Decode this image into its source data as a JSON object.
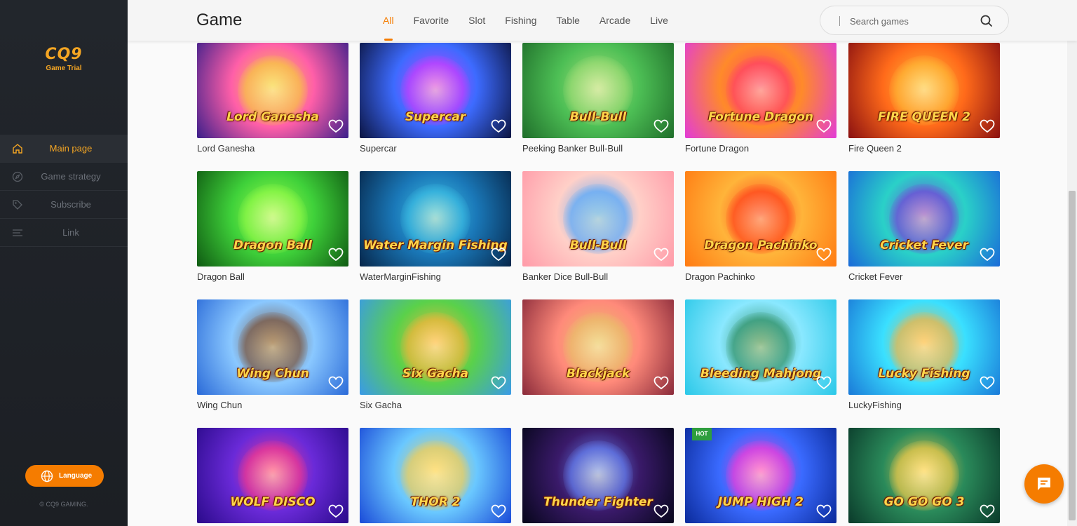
{
  "brand": {
    "logo_text": "CQ9",
    "logo_sub": "Game Trial",
    "accent": "#f57c00"
  },
  "sidebar": {
    "items": [
      {
        "label": "Main page",
        "icon": "home-icon",
        "active": true
      },
      {
        "label": "Game strategy",
        "icon": "compass-icon",
        "active": false
      },
      {
        "label": "Subscribe",
        "icon": "tag-icon",
        "active": false
      },
      {
        "label": "Link",
        "icon": "menu-lines-icon",
        "active": false
      }
    ],
    "language_label": "Language",
    "copyright": "© CQ9 GAMING."
  },
  "header": {
    "title": "Game",
    "tabs": [
      "All",
      "Favorite",
      "Slot",
      "Fishing",
      "Table",
      "Arcade",
      "Live"
    ],
    "active_tab": "All",
    "search_placeholder": "Search games"
  },
  "games": [
    {
      "name": "Lord Ganesha",
      "art_title": "Lord Ganesha",
      "bg": [
        "#3a1e8a",
        "#ff5fa8",
        "#f7d23a"
      ]
    },
    {
      "name": "Supercar",
      "art_title": "Supercar",
      "bg": [
        "#0b1440",
        "#3d6bff",
        "#d43bff"
      ]
    },
    {
      "name": "Peeking Banker Bull-Bull",
      "art_title": "Bull-Bull",
      "bg": [
        "#1f6e2a",
        "#4dbf55",
        "#a8e07a"
      ]
    },
    {
      "name": "Fortune Dragon",
      "art_title": "Fortune Dragon",
      "bg": [
        "#e23bd8",
        "#ff8a2a",
        "#ff3b6b"
      ]
    },
    {
      "name": "Fire Queen 2",
      "art_title": "FIRE QUEEN 2",
      "bg": [
        "#8a1010",
        "#ff6a1a",
        "#ffc13a"
      ]
    },
    {
      "name": "Dragon Ball",
      "art_title": "Dragon Ball",
      "bg": [
        "#0f5a12",
        "#3fd13a",
        "#9bff4a"
      ]
    },
    {
      "name": "WaterMarginFishing",
      "art_title": "Water Margin Fishing",
      "bg": [
        "#06264a",
        "#1a78b8",
        "#3fc4e8"
      ]
    },
    {
      "name": "Banker Dice Bull-Bull",
      "art_title": "Bull-Bull",
      "bg": [
        "#ff9aa8",
        "#ffd0c8",
        "#4aa6ff"
      ]
    },
    {
      "name": "Dragon Pachinko",
      "art_title": "Dragon Pachinko",
      "bg": [
        "#ff7a12",
        "#ffb43a",
        "#ff3a1a"
      ]
    },
    {
      "name": "Cricket Fever",
      "art_title": "Cricket Fever",
      "bg": [
        "#1a6ad8",
        "#2ad1c8",
        "#7a3ad8"
      ]
    },
    {
      "name": "Wing Chun",
      "art_title": "Wing Chun",
      "bg": [
        "#2a6ad8",
        "#8ac8ff",
        "#7a4a2a"
      ]
    },
    {
      "name": "Six Gacha",
      "art_title": "Six Gacha",
      "bg": [
        "#3a9ae8",
        "#5ad14a",
        "#ffb43a"
      ]
    },
    {
      "name": "",
      "art_title": "Blackjack",
      "bg": [
        "#8a2a3a",
        "#ff8a7a",
        "#e8c46a"
      ]
    },
    {
      "name": "",
      "art_title": "Bleeding Mahjong",
      "bg": [
        "#2ac8e8",
        "#8ae8ff",
        "#2a8a5a"
      ]
    },
    {
      "name": "LuckyFishing",
      "art_title": "Lucky Fishing",
      "bg": [
        "#1a7ad8",
        "#3ae0ff",
        "#ffb43a"
      ]
    },
    {
      "name": "",
      "art_title": "WOLF DISCO",
      "bg": [
        "#2a0a8a",
        "#6a2ad8",
        "#ff3a8a"
      ]
    },
    {
      "name": "",
      "art_title": "THOR 2",
      "bg": [
        "#1a4ad8",
        "#6ac8ff",
        "#ffd04a"
      ]
    },
    {
      "name": "",
      "art_title": "Thunder Fighter",
      "bg": [
        "#06061a",
        "#3a1a6a",
        "#6a8aff"
      ]
    },
    {
      "name": "",
      "art_title": "JUMP HIGH 2",
      "bg": [
        "#0a2a9a",
        "#3a6aff",
        "#ff3ad8"
      ],
      "hot": "HOT"
    },
    {
      "name": "",
      "art_title": "GO GO GO 3",
      "bg": [
        "#0a3a2a",
        "#2a8a5a",
        "#ffd04a"
      ]
    }
  ]
}
